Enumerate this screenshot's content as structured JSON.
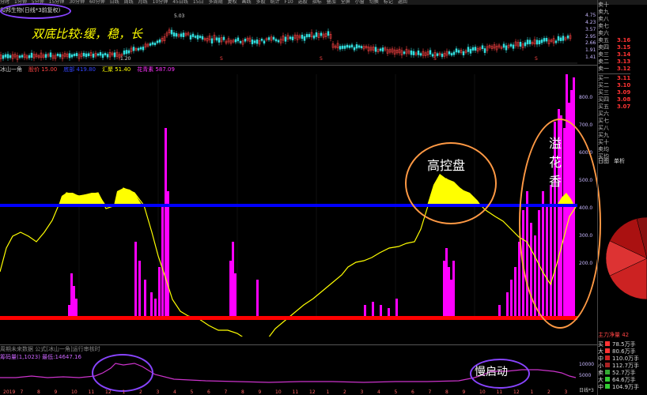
{
  "menu_items": [
    "分时",
    "1分钟",
    "5分钟",
    "15分钟",
    "30分钟",
    "60分钟",
    "日线",
    "周线",
    "月线",
    "10分钟",
    "45日线",
    "15日",
    "多周期",
    "复权",
    "画线",
    "多股",
    "统计",
    "F10",
    "选股",
    "指标",
    "叠加",
    "全屏",
    "小窗",
    "切换",
    "标记",
    "返回"
  ],
  "title": "和邦生物(日线*3前复权)",
  "top_annotation": "双底比较:缓，稳，长",
  "top_axis": [
    "4.75",
    "4.23",
    "3.57",
    "2.95",
    "2.66",
    "1.91",
    "1.41"
  ],
  "top_peak": "5.03",
  "top_low": "1.20",
  "panel_header": [
    {
      "text": "冰山一角",
      "color": "#cccccc"
    },
    {
      "text": "股价 15.00",
      "color": "#ff4444"
    },
    {
      "text": "底部 419.80",
      "color": "#3344ff"
    },
    {
      "text": "汇聚 51.40",
      "color": "#ffff00"
    },
    {
      "text": "花青素 587.09",
      "color": "#ff33ff"
    }
  ],
  "main_axis": [
    "800.0",
    "700.0",
    "600.0",
    "500.0",
    "400.0",
    "300.0",
    "200.0"
  ],
  "label_high_control": "高控盘",
  "label_overflow": [
    "溢",
    "花",
    "香"
  ],
  "sub_info": "周期未来数据 公式[冰山一角]运行审核时",
  "sub_header": "筹码量(1,1023) 最低:14647.16",
  "label_slow_start": "慢启动",
  "sub_axis": [
    "10000",
    "5000"
  ],
  "bottom_axis_label": "日线*3",
  "right_panel": {
    "sell": [
      {
        "label": "卖十",
        "value": ""
      },
      {
        "label": "卖九",
        "value": ""
      },
      {
        "label": "卖八",
        "value": ""
      },
      {
        "label": "卖七",
        "value": ""
      },
      {
        "label": "卖六",
        "value": ""
      },
      {
        "label": "卖五",
        "value": "3.16"
      },
      {
        "label": "卖四",
        "value": "3.15"
      },
      {
        "label": "卖三",
        "value": "3.14"
      },
      {
        "label": "卖二",
        "value": "3.13"
      },
      {
        "label": "卖一",
        "value": "3.12"
      }
    ],
    "buy": [
      {
        "label": "买一",
        "value": "3.11"
      },
      {
        "label": "买二",
        "value": "3.10"
      },
      {
        "label": "买三",
        "value": "3.09"
      },
      {
        "label": "买四",
        "value": "3.08"
      },
      {
        "label": "买五",
        "value": "3.07"
      },
      {
        "label": "买六",
        "value": ""
      },
      {
        "label": "买七",
        "value": ""
      },
      {
        "label": "买八",
        "value": ""
      },
      {
        "label": "买九",
        "value": ""
      },
      {
        "label": "买十",
        "value": ""
      }
    ],
    "sell_avg": "卖均",
    "buy_avg": "买均",
    "tabs": [
      "日图",
      "单析"
    ],
    "main_net": "主力净量 42",
    "flow_rows": [
      {
        "tag": "买",
        "color": "#ff3333",
        "value": "78.5万手"
      },
      {
        "tag": "大",
        "color": "#ff3333",
        "value": "80.6万手"
      },
      {
        "tag": "中",
        "color": "#cc2222",
        "value": "110.0万手"
      },
      {
        "tag": "小",
        "color": "#aa2222",
        "value": "112.7万手"
      },
      {
        "tag": "卖",
        "color": "#33aa33",
        "value": "52.7万手"
      },
      {
        "tag": "大",
        "color": "#33cc33",
        "value": "64.6万手"
      },
      {
        "tag": "中",
        "color": "#33cc33",
        "value": "104.9万手"
      }
    ]
  },
  "colors": {
    "pink": "#ff00ff",
    "yellow": "#ffff00",
    "blue": "#0000ff",
    "red": "#ff0000",
    "purple": "#8844ff",
    "orange": "#ff9944",
    "pie_red": "#cc2222",
    "pie_green": "#33bb33"
  }
}
